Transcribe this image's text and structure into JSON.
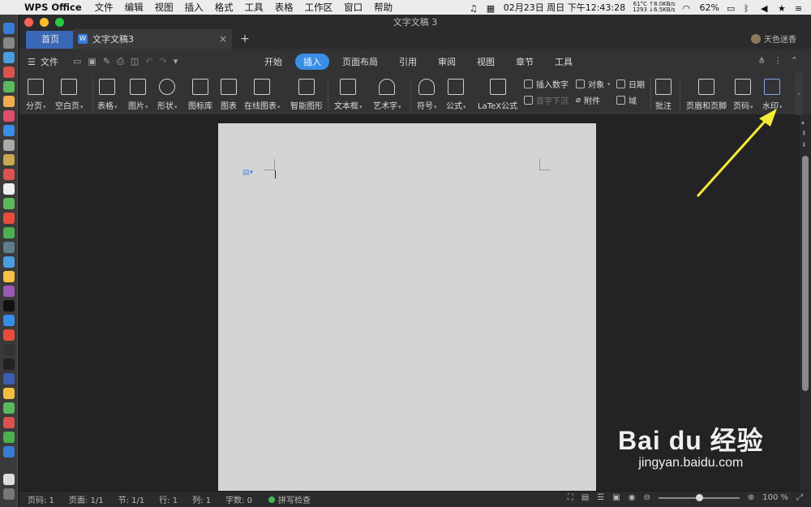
{
  "menubar": {
    "app_name": "WPS Office",
    "items": [
      "文件",
      "编辑",
      "视图",
      "插入",
      "格式",
      "工具",
      "表格",
      "工作区",
      "窗口",
      "帮助"
    ],
    "datetime": "02月23日 周日 下午12:43:28",
    "net_line1": "61°C ↑8.0KB/s",
    "net_line2": "1293 ↓6.5KB/s",
    "battery": "62%"
  },
  "window": {
    "title": "文字文稿 3",
    "tab_home": "首页",
    "tab_doc": "文字文稿3",
    "tab_doc_close": "×",
    "tab_add": "+",
    "user_name": "天色迷香"
  },
  "toolbar": {
    "file_label": "文件",
    "tabs": [
      "开始",
      "插入",
      "页面布局",
      "引用",
      "审阅",
      "视图",
      "章节",
      "工具"
    ],
    "active_tab": "插入"
  },
  "ribbon": {
    "items": [
      {
        "label": "分页",
        "caret": true
      },
      {
        "label": "空白页",
        "caret": true
      },
      {
        "label": "表格",
        "caret": true
      },
      {
        "label": "图片",
        "caret": true
      },
      {
        "label": "形状",
        "caret": true
      },
      {
        "label": "图标库",
        "caret": false
      },
      {
        "label": "图表",
        "caret": false
      },
      {
        "label": "在线图表",
        "caret": true
      },
      {
        "label": "智能图形",
        "caret": false
      },
      {
        "label": "文本框",
        "caret": true
      },
      {
        "label": "艺术字",
        "caret": true
      },
      {
        "label": "符号",
        "caret": true
      },
      {
        "label": "公式",
        "caret": true
      },
      {
        "label": "LaTeX公式",
        "caret": false
      },
      {
        "label": "批注",
        "caret": false
      },
      {
        "label": "页眉和页脚",
        "caret": false
      },
      {
        "label": "页码",
        "caret": true
      },
      {
        "label": "水印",
        "caret": true
      }
    ],
    "small": {
      "insert_number": "插入数字",
      "drop_cap": "首字下沉",
      "object": "对象",
      "attachment": "附件",
      "date": "日期",
      "field": "域"
    }
  },
  "status": {
    "page_code": "页码: 1",
    "page": "页面: 1/1",
    "section": "节: 1/1",
    "row": "行: 1",
    "col": "列: 1",
    "word_count": "字数: 0",
    "spell_check": "拼写检查",
    "zoom": "100 %"
  },
  "watermark": {
    "logo": "Bai du 经验",
    "url": "jingyan.baidu.com"
  },
  "colors": {
    "accent": "#3a8ee6",
    "annotation_arrow": "#f5ea3a"
  }
}
